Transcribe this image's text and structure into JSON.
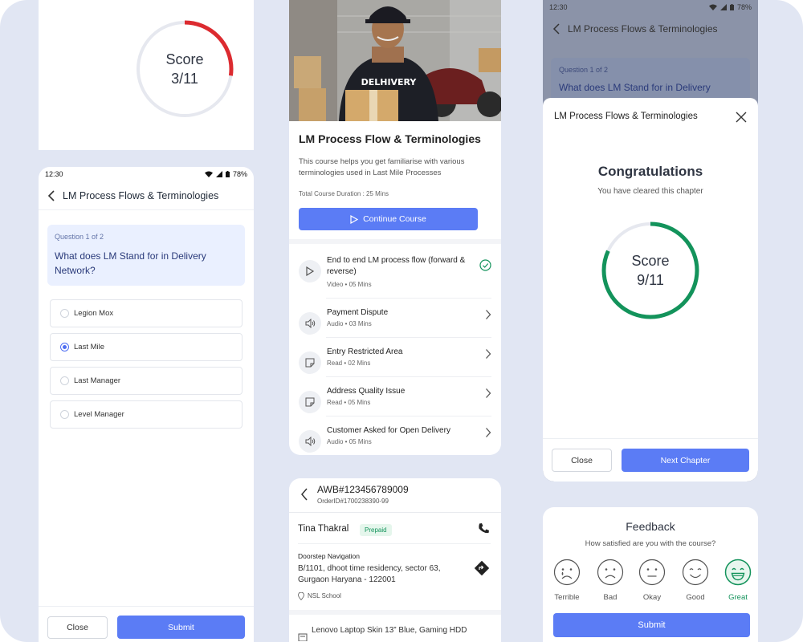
{
  "colors": {
    "primary": "#5b7cf5",
    "score_low": "#dc2b30",
    "score_high": "#13935b",
    "track": "#e6e8ef",
    "background": "#e1e6f3"
  },
  "score_card": {
    "label": "Score",
    "value": "3/11",
    "fraction": 0.2727
  },
  "quiz": {
    "status": {
      "time": "12:30",
      "battery": "78%"
    },
    "app_title": "LM Process Flows & Terminologies",
    "question_number": "Question 1 of 2",
    "question": "What does LM Stand for in Delivery Network?",
    "options": [
      {
        "label": "Legion Mox",
        "selected": false
      },
      {
        "label": "Last Mile",
        "selected": true
      },
      {
        "label": "Last Manager",
        "selected": false
      },
      {
        "label": "Level Manager",
        "selected": false
      }
    ],
    "close_label": "Close",
    "submit_label": "Submit"
  },
  "course": {
    "hero_shirt_text": "DELHIVERY",
    "title": "LM Process Flow & Terminologies",
    "description": "This course helps you get familiarise with various terminologies used in Last Mile Processes",
    "duration": "Total Course Duration : 25 Mins",
    "continue_label": "Continue Course",
    "lessons": [
      {
        "title": "End to end LM process flow (forward & reverse)",
        "meta": "Video  •  05 Mins",
        "icon": "play-icon",
        "status": "completed"
      },
      {
        "title": "Payment Dispute",
        "meta": "Audio  •  03 Mins",
        "icon": "speaker-icon",
        "status": "open"
      },
      {
        "title": "Entry Restricted Area",
        "meta": "Read • 02 Mins",
        "icon": "note-icon",
        "status": "open"
      },
      {
        "title": "Address Quality Issue",
        "meta": "Read • 05 Mins",
        "icon": "note-icon",
        "status": "open"
      },
      {
        "title": "Customer Asked for Open Delivery",
        "meta": "Audio • 05 Mins",
        "icon": "speaker-icon",
        "status": "open"
      }
    ]
  },
  "order": {
    "awb": "AWB#123456789009",
    "order_id": "OrderID#1700238390-99",
    "customer_name": "Tina Thakral",
    "payment_badge": "Prepaid",
    "nav_label": "Doorstep Navigation",
    "address": "B/1101, dhoot time residency, sector 63, Gurgaon Haryana - 122001",
    "landmark": "NSL School",
    "item": "Lenovo Laptop Skin 13” Blue, Gaming HDD"
  },
  "congrats": {
    "status": {
      "time": "12:30",
      "battery": "78%"
    },
    "bg_title": "LM Process Flows & Terminologies",
    "bg_question_number": "Question 1 of 2",
    "bg_question": "What does LM Stand for in Delivery",
    "sheet_title": "LM Process Flows & Terminologies",
    "heading": "Congratulations",
    "subheading": "You have cleared this chapter",
    "score_label": "Score",
    "score_value": "9/11",
    "score_fraction": 0.8182,
    "close_label": "Close",
    "next_label": "Next Chapter"
  },
  "feedback": {
    "title": "Feedback",
    "question": "How satisfied are you with the course?",
    "options": [
      {
        "label": "Terrible",
        "selected": false
      },
      {
        "label": "Bad",
        "selected": false
      },
      {
        "label": "Okay",
        "selected": false
      },
      {
        "label": "Good",
        "selected": false
      },
      {
        "label": "Great",
        "selected": true
      }
    ],
    "submit_label": "Submit"
  }
}
